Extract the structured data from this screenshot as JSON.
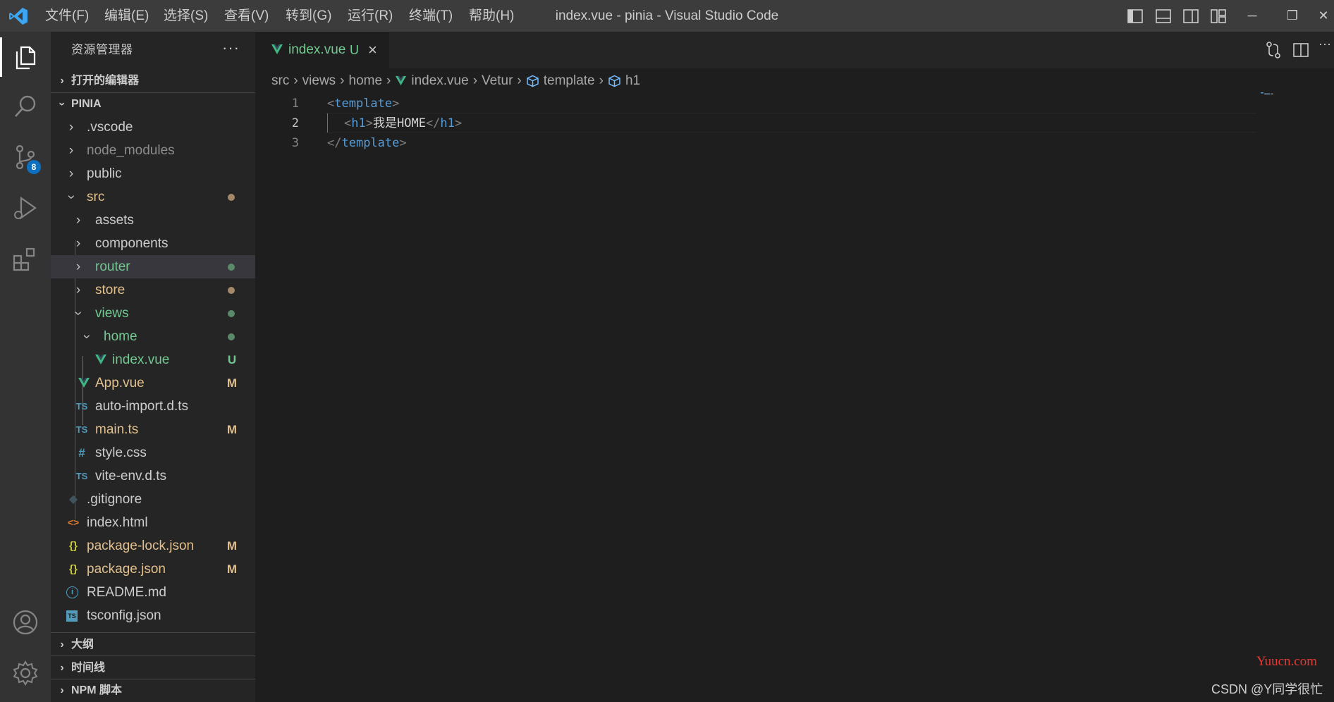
{
  "window": {
    "title": "index.vue - pinia - Visual Studio Code",
    "menu": [
      "文件(F)",
      "编辑(E)",
      "选择(S)",
      "查看(V)",
      "转到(G)",
      "运行(R)",
      "终端(T)",
      "帮助(H)"
    ]
  },
  "activity_bar": {
    "items": [
      "explorer-icon",
      "search-icon",
      "source-control-icon",
      "run-debug-icon",
      "extensions-icon"
    ],
    "source_control_badge": "8",
    "bottom": [
      "account-icon",
      "settings-gear-icon"
    ]
  },
  "sidebar": {
    "title": "资源管理器",
    "more": "···",
    "open_editors": "打开的编辑器",
    "project": "PINIA",
    "tree": [
      {
        "label": ".vscode"
      },
      {
        "label": "node_modules"
      },
      {
        "label": "public"
      },
      {
        "label": "src"
      },
      {
        "label": "assets"
      },
      {
        "label": "components"
      },
      {
        "label": "router"
      },
      {
        "label": "store"
      },
      {
        "label": "views"
      },
      {
        "label": "home"
      },
      {
        "label": "index.vue",
        "status": "U"
      },
      {
        "label": "App.vue",
        "status": "M"
      },
      {
        "label": "auto-import.d.ts",
        "icon": "TS"
      },
      {
        "label": "main.ts",
        "icon": "TS",
        "status": "M"
      },
      {
        "label": "style.css",
        "icon": "#"
      },
      {
        "label": "vite-env.d.ts",
        "icon": "TS"
      },
      {
        "label": ".gitignore"
      },
      {
        "label": "index.html",
        "icon": "<>"
      },
      {
        "label": "package-lock.json",
        "icon": "{}",
        "status": "M"
      },
      {
        "label": "package.json",
        "icon": "{}",
        "status": "M"
      },
      {
        "label": "README.md",
        "icon": "i"
      },
      {
        "label": "tsconfig.json",
        "icon": "TS"
      }
    ],
    "outline": "大纲",
    "timeline": "时间线",
    "npm": "NPM 脚本"
  },
  "editor": {
    "tab": {
      "name": "index.vue",
      "status": "U",
      "close": "×"
    },
    "breadcrumb": [
      "src",
      "views",
      "home",
      "index.vue",
      "Vetur",
      "template",
      "h1"
    ],
    "lines": [
      {
        "num": "1",
        "open": "<",
        "tag": "template",
        "close": ">"
      },
      {
        "num": "2",
        "open": "<",
        "tag": "h1",
        "close": ">",
        "text": "我是HOME",
        "endopen": "</",
        "endtag": "h1",
        "endclose": ">"
      },
      {
        "num": "3",
        "open": "</",
        "tag": "template",
        "close": ">"
      }
    ]
  },
  "watermarks": {
    "site": "Yuucn.com",
    "author": "CSDN @Y同学很忙"
  },
  "colors": {
    "accent": "#0e70c0",
    "git_added": "#73c991",
    "git_modified": "#e2c08d",
    "vue_green": "#41b883",
    "tag_blue": "#569cd6"
  }
}
